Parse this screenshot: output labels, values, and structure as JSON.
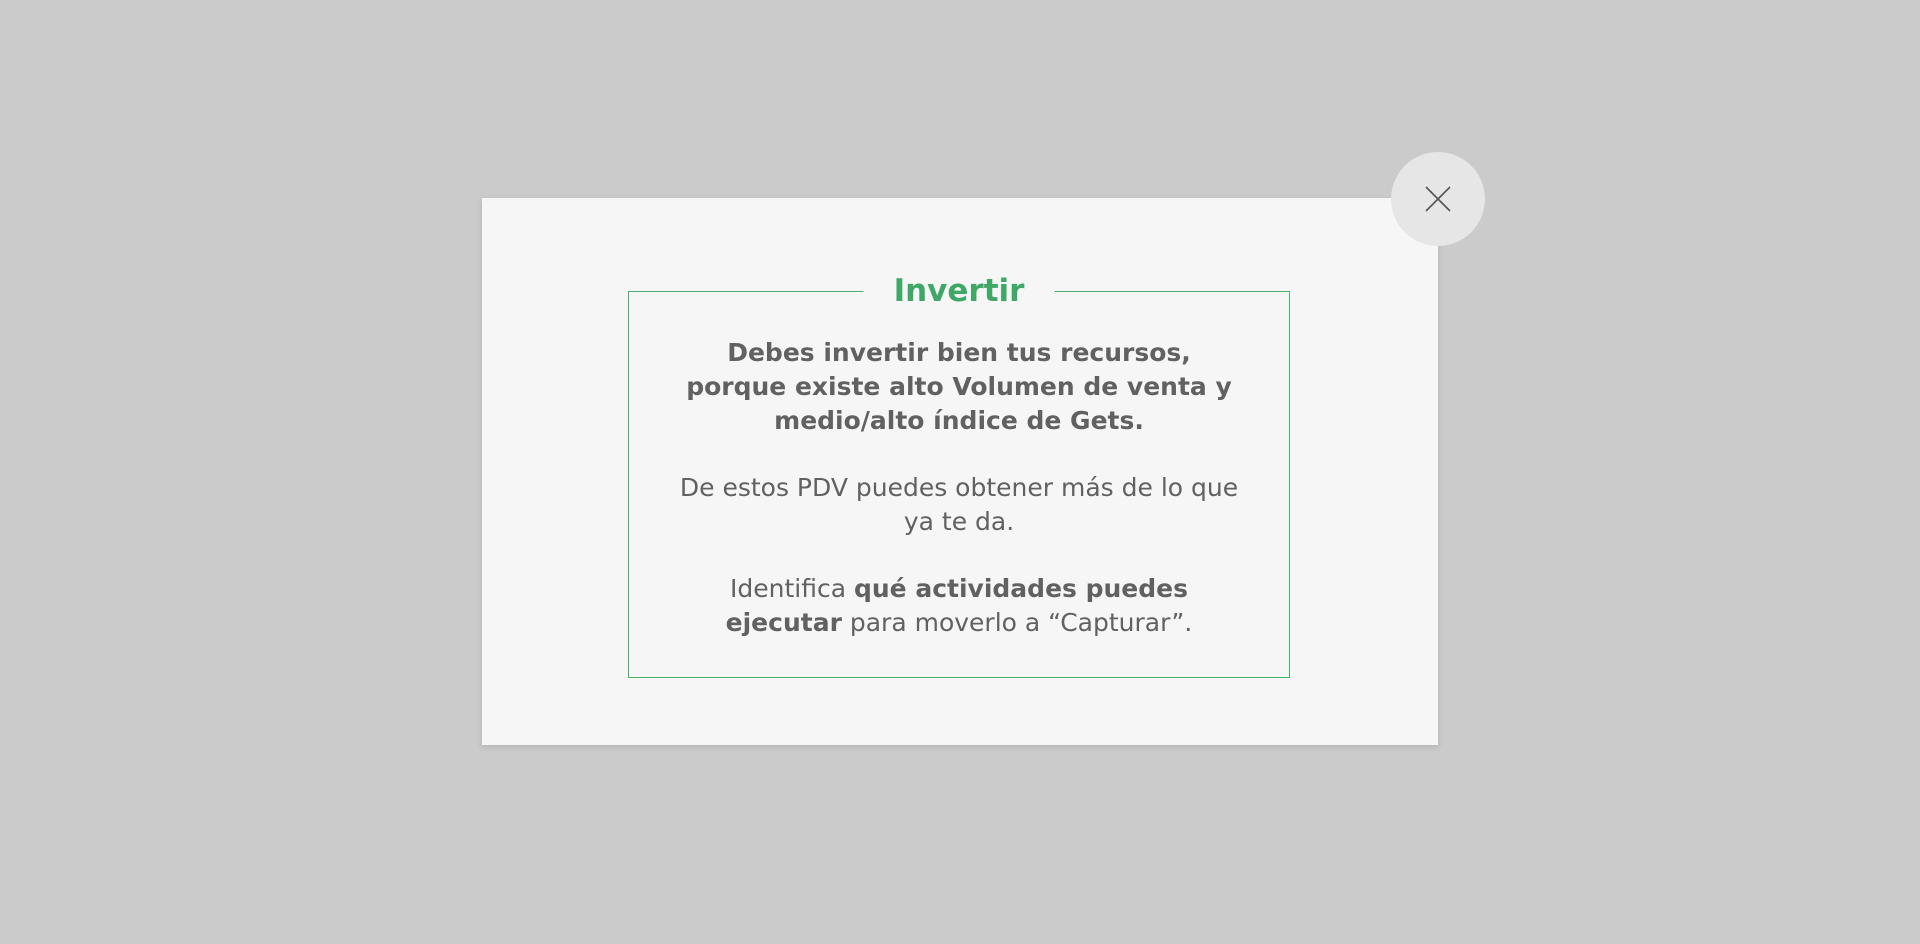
{
  "dialog": {
    "title": "Invertir",
    "paragraph1": "Debes invertir bien tus recursos, porque existe alto Volumen de venta y medio/alto índice de Gets.",
    "paragraph2": "De estos PDV puedes obtener más de lo que ya te da.",
    "paragraph3": {
      "prefix": "Identifica ",
      "bold": "qué actividades puedes ejecutar",
      "suffix": " para moverlo a “Capturar”."
    },
    "close_icon": "close-icon"
  },
  "colors": {
    "background": "#cbcbcb",
    "modal": "#f6f6f6",
    "accent": "#3fa866",
    "text": "#616161",
    "close_button": "#e6e6e6"
  }
}
